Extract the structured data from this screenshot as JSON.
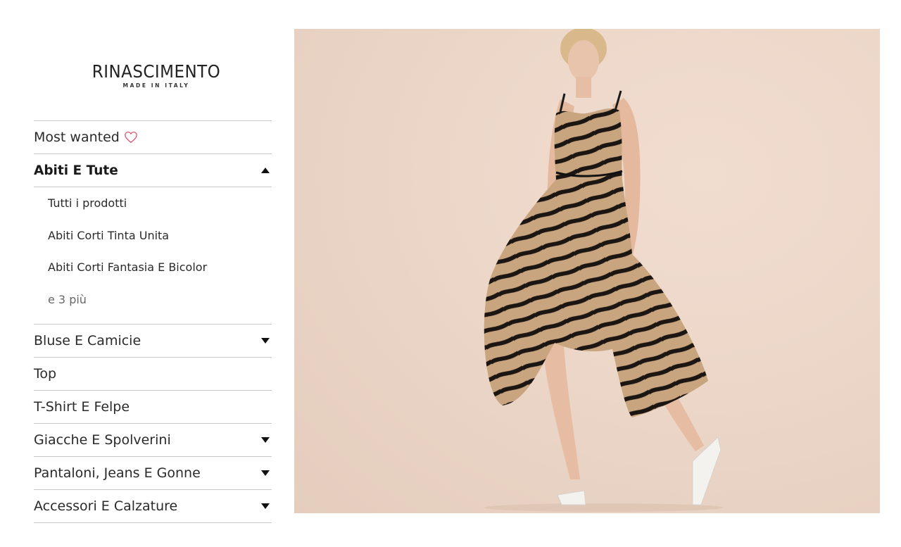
{
  "brand": {
    "name": "RINASCIMENTO",
    "tagline": "MADE IN ITALY"
  },
  "menu": {
    "most_wanted": "Most wanted",
    "active_category": "Abiti E Tute",
    "subitems": [
      "Tutti i prodotti",
      "Abiti Corti Tinta Unita",
      "Abiti Corti Fantasia E Bicolor"
    ],
    "more_link": "e 3 più",
    "categories": [
      "Bluse E Camicie",
      "Top",
      "T-Shirt E Felpe",
      "Giacche E Spolverini",
      "Pantaloni, Jeans E Gonne",
      "Accessori E Calzature"
    ]
  },
  "icons": {
    "heart": "heart-icon",
    "expand": "caret-down-icon",
    "collapse": "caret-up-icon"
  },
  "colors": {
    "heart": "#e0566f",
    "divider": "#c9c9c9",
    "hero_background": "#ecd6c8"
  }
}
